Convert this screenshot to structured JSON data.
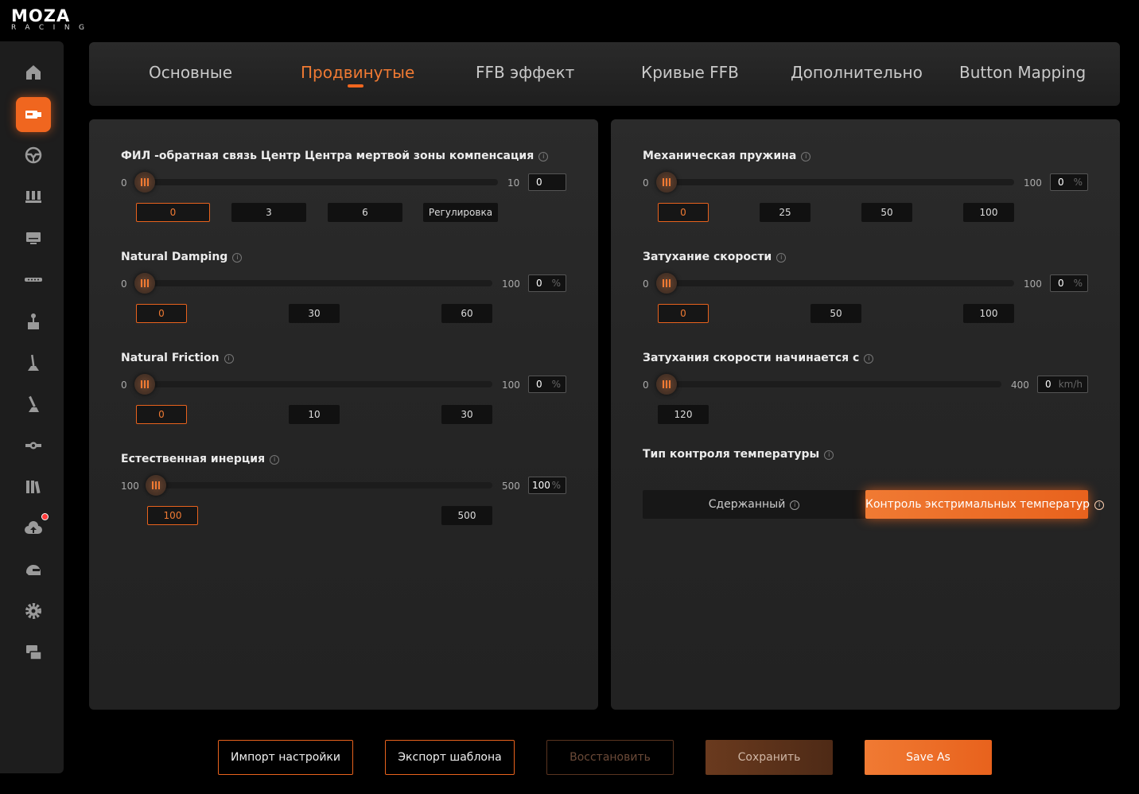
{
  "brand": {
    "name": "MOZA",
    "sub": "RACING"
  },
  "sidebar": {
    "items": [
      {
        "icon": "home-icon"
      },
      {
        "icon": "wheelbase-icon",
        "active": true
      },
      {
        "icon": "steering-wheel-icon"
      },
      {
        "icon": "pedals-icon"
      },
      {
        "icon": "dashboard-icon"
      },
      {
        "icon": "rpm-bar-icon"
      },
      {
        "icon": "shifter-icon"
      },
      {
        "icon": "handbrake-icon"
      },
      {
        "icon": "sequential-shifter-icon"
      },
      {
        "icon": "hub-icon"
      },
      {
        "icon": "library-icon"
      },
      {
        "icon": "cloud-upload-icon",
        "badge": true
      },
      {
        "icon": "helmet-icon"
      },
      {
        "icon": "settings-icon"
      },
      {
        "icon": "faq-icon"
      }
    ]
  },
  "tabs": [
    {
      "label": "Основные"
    },
    {
      "label": "Продвинутые",
      "active": true
    },
    {
      "label": "FFB эффект"
    },
    {
      "label": "Кривые FFB"
    },
    {
      "label": "Дополнительно"
    },
    {
      "label": "Button Mapping"
    }
  ],
  "left_panel": {
    "s1": {
      "label": "ФИЛ -обратная связь Центр Центра мертвой зоны компенсация",
      "min": "0",
      "max": "10",
      "value": "0",
      "level": 0,
      "presets": [
        "0",
        "3",
        "6",
        "Регулировка"
      ]
    },
    "s2": {
      "label": "Natural Damping",
      "min": "0",
      "max": "100",
      "value": "0",
      "unit": "%",
      "level": 0,
      "presets": [
        "0",
        "30",
        "60"
      ]
    },
    "s3": {
      "label": "Natural Friction",
      "min": "0",
      "max": "100",
      "value": "0",
      "unit": "%",
      "level": 0,
      "presets": [
        "0",
        "10",
        "30"
      ]
    },
    "s4": {
      "label": "Естественная инерция",
      "min": "100",
      "max": "500",
      "value": "100",
      "unit": "%",
      "level": 100,
      "presets": [
        "100",
        "500"
      ]
    }
  },
  "right_panel": {
    "s1": {
      "label": "Механическая пружина",
      "min": "0",
      "max": "100",
      "value": "0",
      "unit": "%",
      "level": 0,
      "presets": [
        "0",
        "25",
        "50",
        "100"
      ]
    },
    "s2": {
      "label": "Затухание скорости",
      "min": "0",
      "max": "100",
      "value": "0",
      "unit": "%",
      "level": 0,
      "presets": [
        "0",
        "50",
        "100"
      ]
    },
    "s3": {
      "label": "Затухания скорости начинается с",
      "min": "0",
      "max": "400",
      "value": "0",
      "unit": "km/h",
      "level": 0,
      "presets": [
        "120"
      ]
    },
    "temp": {
      "label": "Тип контроля температуры",
      "options": [
        "Сдержанный",
        "Контроль экстримальных температур"
      ],
      "selected": 1
    }
  },
  "footer": {
    "import": "Импорт настройки",
    "export": "Экспорт шаблона",
    "restore": "Восстановить",
    "save": "Сохранить",
    "save_as": "Save As"
  },
  "colors": {
    "accent": "#f0661f",
    "panel": "#262626",
    "background": "#000000"
  }
}
